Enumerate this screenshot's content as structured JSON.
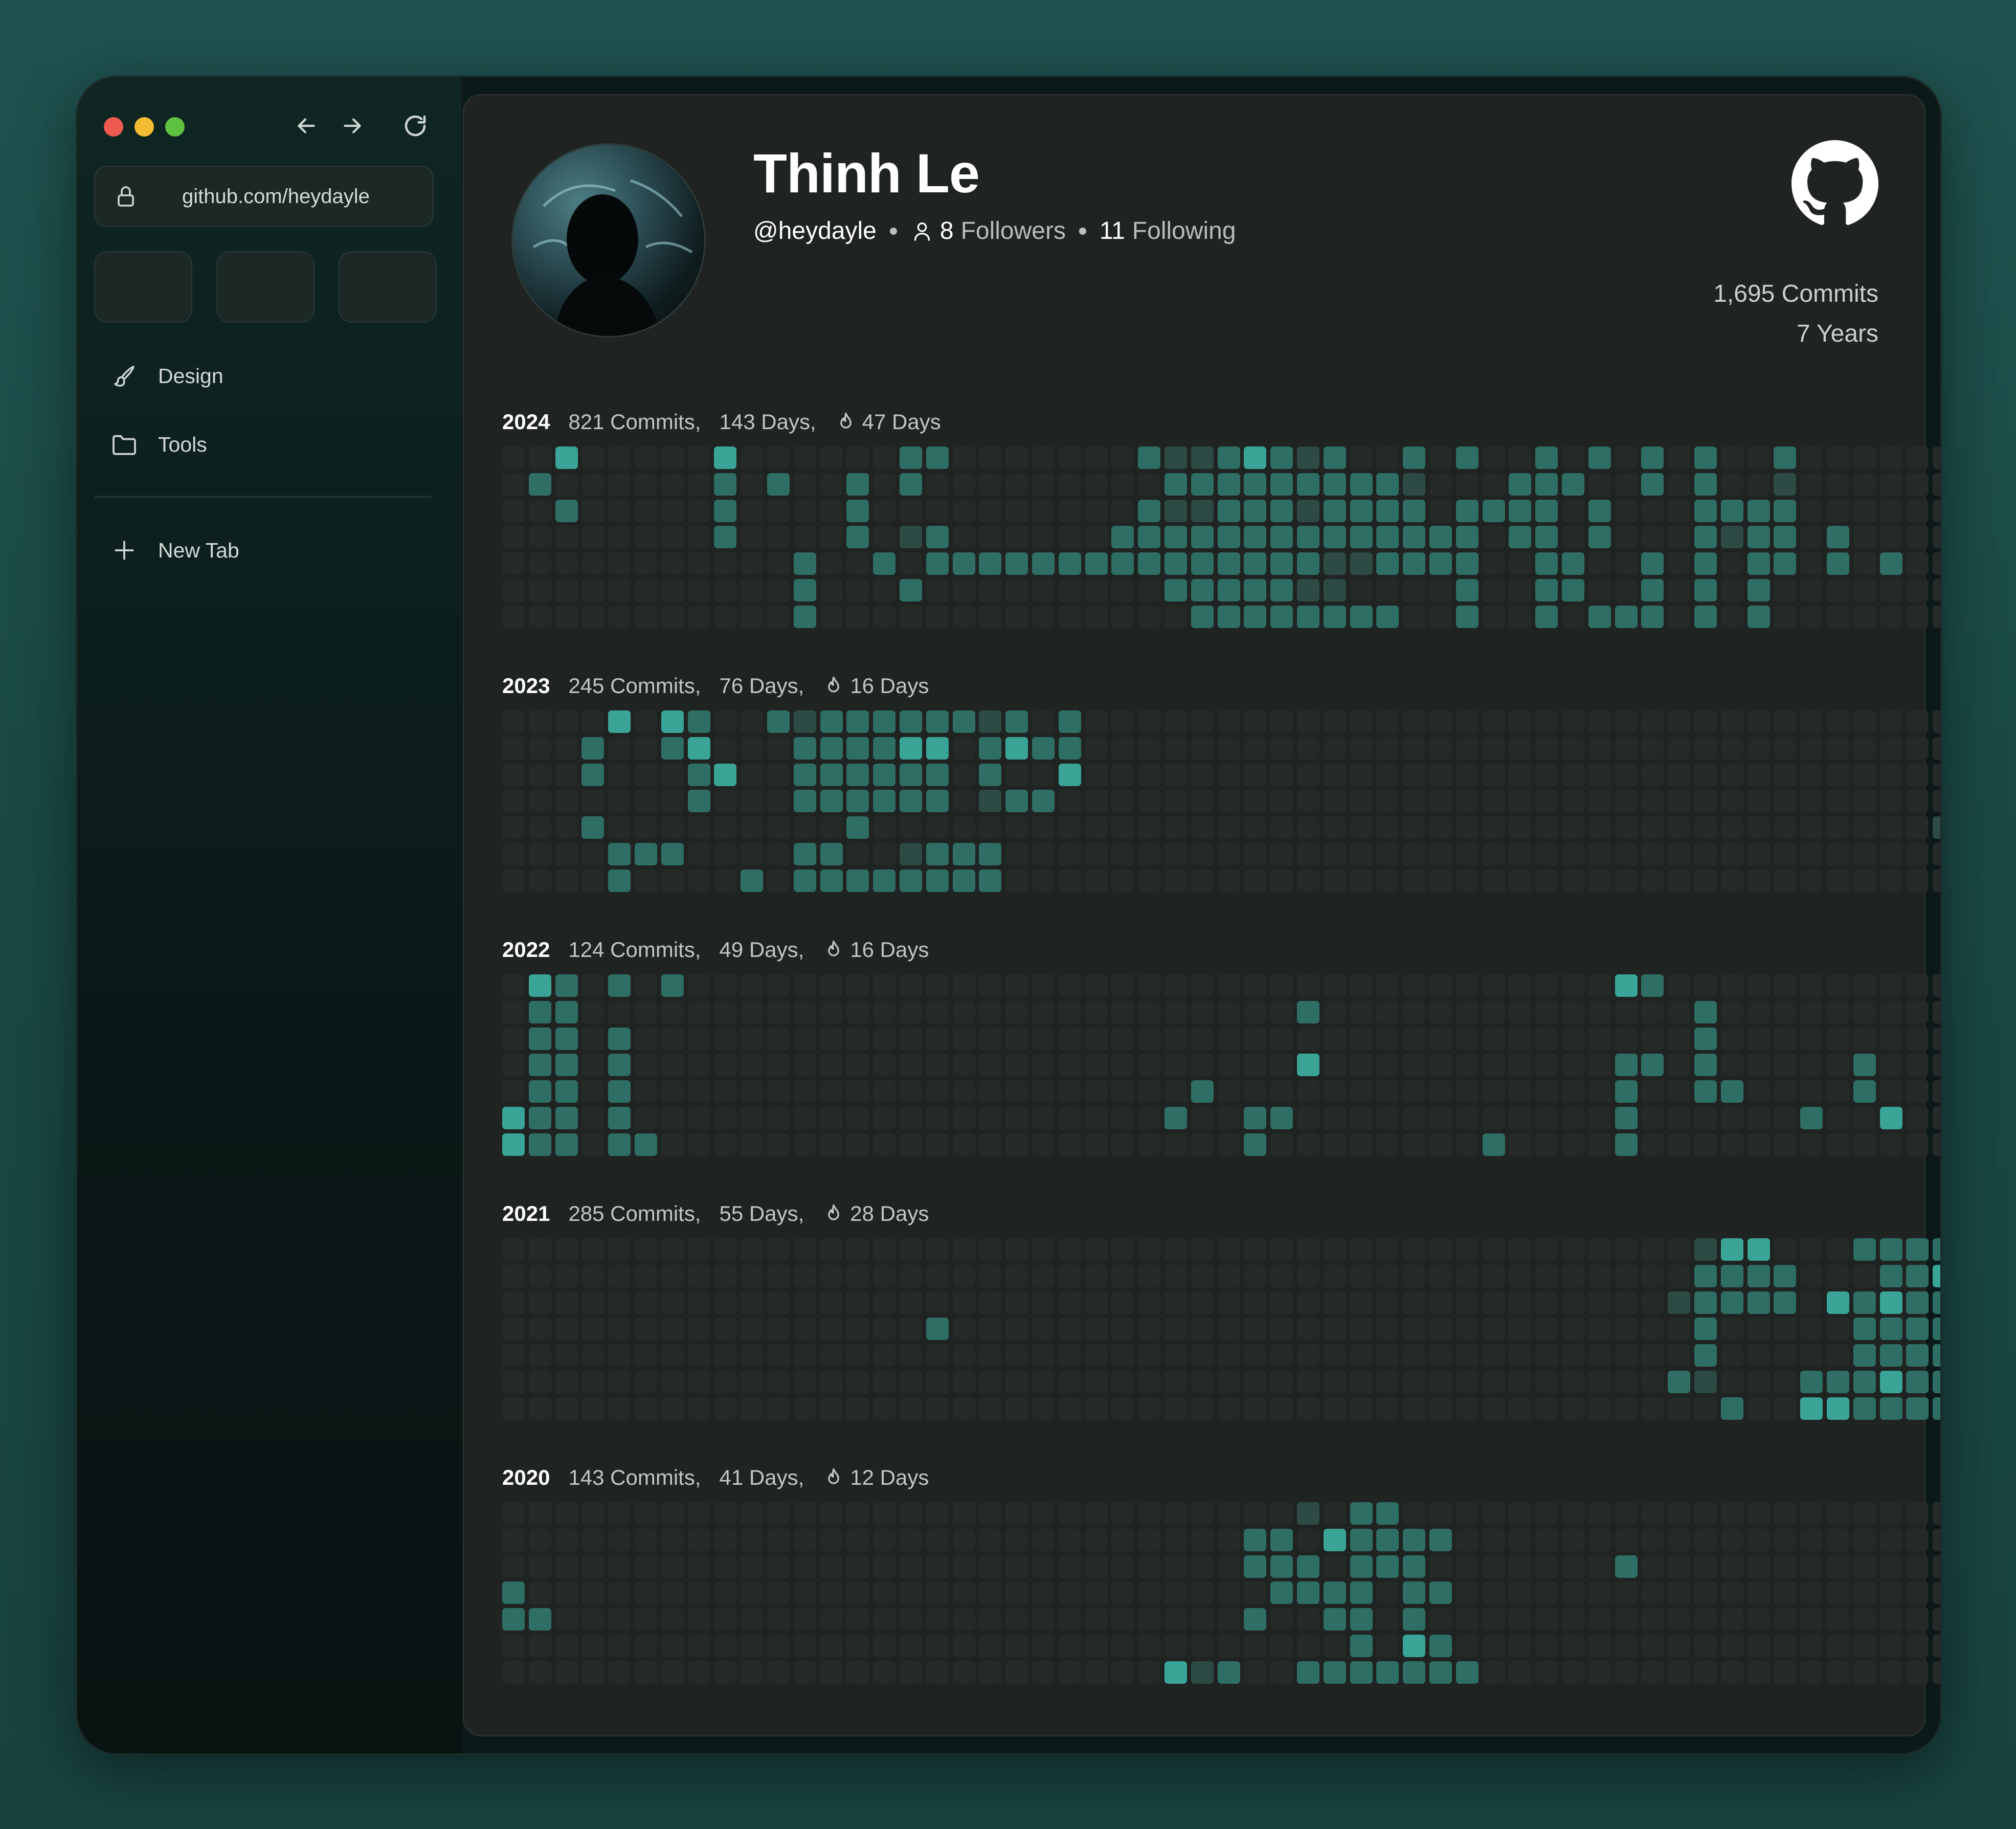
{
  "browser": {
    "url": "github.com/heydayle",
    "sidebar": [
      {
        "label": "Design",
        "icon": "brush-icon"
      },
      {
        "label": "Tools",
        "icon": "folder-icon"
      }
    ],
    "new_tab_label": "New Tab"
  },
  "profile": {
    "name": "Thinh Le",
    "handle": "@heydayle",
    "followers_count": "8",
    "followers_label": "Followers",
    "following_count": "11",
    "following_label": "Following",
    "total_commits": "1,695 Commits",
    "total_years": "7 Years"
  },
  "colors": {
    "level0": "#252928",
    "level1": "#2d4a45",
    "level2": "#2f6e64",
    "level3": "#3aa597",
    "accent": "#3aa597"
  },
  "years": [
    {
      "year": "2024",
      "commits": "821 Commits,",
      "days": "143 Days,",
      "streak": "47 Days",
      "rows": [
        "0030000030000002200000002112321200202002020202002000000",
        "0200000020200202000000000222222222100022200202001000000",
        "0020000020000200000000002112221222202222020002222000000",
        "0000000020000201200000022222222222222022020002122020000",
        "0000000000020020222222222222222112222002200202022020200",
        "0000000000020002000000000222221100002002200202020000000",
        "0000000000020000000000000022222222002002022202020000000"
      ]
    },
    {
      "year": "2023",
      "commits": "245 Commits,",
      "days": "76 Days,",
      "streak": "16 Days",
      "rows": [
        "0000303200212222221202000000000000000000000000000000000",
        "0002002300022223302322000000000000000000000000000000000",
        "0002000230022222202003000000000000000000000000000000000",
        "0000000200022222201220000000000000000000000000000000000",
        "0002000000000200000000000000000000000000000000000000001",
        "0000222000022001222000000000000000000000000000000000000",
        "0000200002022222222000000000000000000000000000000000000"
      ]
    },
    {
      "year": "2022",
      "commits": "124 Commits,",
      "days": "49 Days,",
      "streak": "16 Days",
      "rows": [
        "0320202000000000000000000000000000000000003200000000000",
        "0220000000000000000000000000002000000000000002000000000",
        "0220200000000000000000000000000000000000000002000000000",
        "0220200000000000000000000000003000000000002202000002000",
        "0220200000000000000000000020000000000000002002200002000",
        "3220200000000000000000000200220000000000002000000200300",
        "3220220000000000000000000000200000000200002000000000000"
      ]
    },
    {
      "year": "2021",
      "commits": "285 Commits,",
      "days": "55 Days,",
      "streak": "28 Days",
      "rows": [
        "0000000000000000000000000000000000000000000001330002222",
        "0000000000000000000000000000000000000000000002222000223",
        "0000000000000000000000000000000000000000000012222032322",
        "0000000000000000200000000000000000000000000002000002222",
        "0000000000000000000000000000000000000000000002000002222",
        "0000000000000000000000000000000000000000000021000222322",
        "0000000000000000000000000000000000000000000000200332222"
      ]
    },
    {
      "year": "2020",
      "commits": "143 Commits,",
      "days": "41 Days,",
      "streak": "12 Days",
      "rows": [
        "0000000000000000000000000000001022000000000000000000000",
        "0000000000000000000000000000220322220000000000000000000",
        "0000000000000000000000000000222022200000002000000000000",
        "2000000000000000000000000000022220220000000000000000000",
        "2200000000000000000000000000200220200000000000000000000",
        "0000000000000000000000000000000020320000000000000000000",
        "0000000000000000000000000312002222222000000000000000000"
      ]
    }
  ]
}
